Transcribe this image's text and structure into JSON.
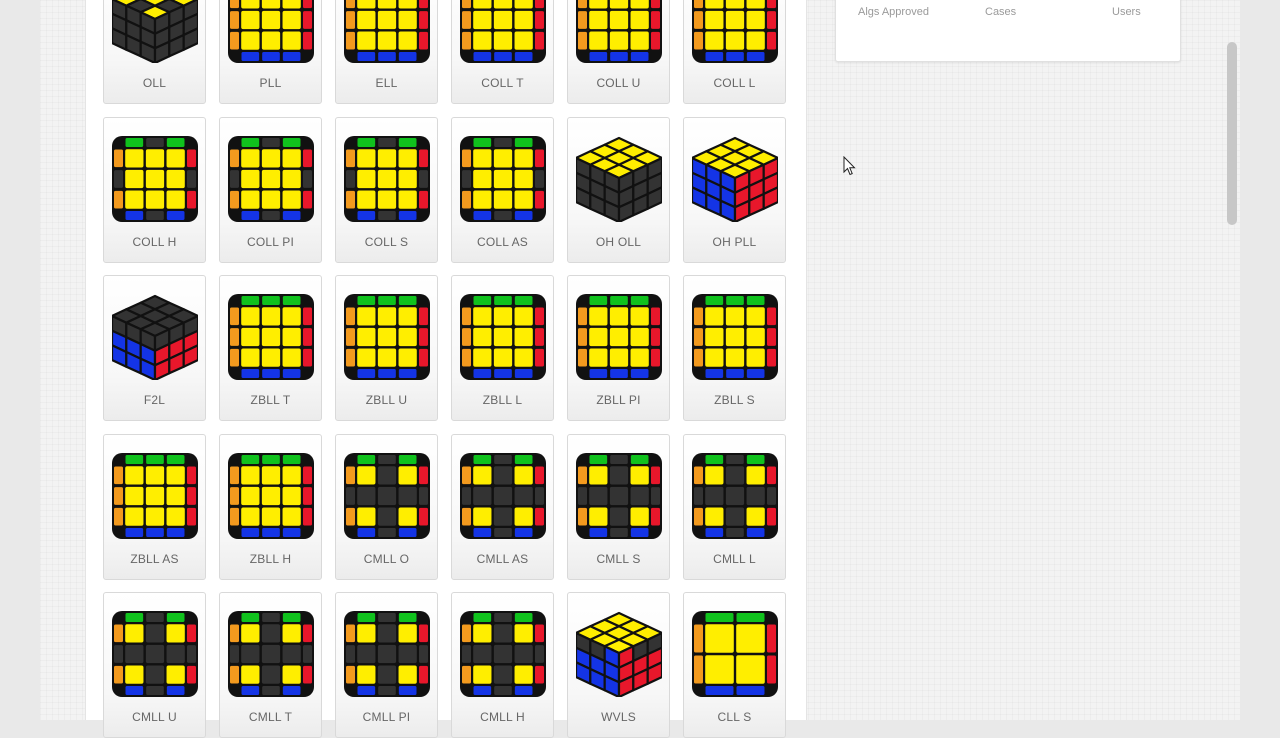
{
  "algsets": [
    {
      "label": "OLL",
      "icon": "oll-cube-icon"
    },
    {
      "label": "PLL",
      "icon": "pll-cube-icon"
    },
    {
      "label": "ELL",
      "icon": "ell-cube-icon"
    },
    {
      "label": "COLL T",
      "icon": "coll-t-cube-icon"
    },
    {
      "label": "COLL U",
      "icon": "coll-u-cube-icon"
    },
    {
      "label": "COLL L",
      "icon": "coll-l-cube-icon"
    },
    {
      "label": "COLL H",
      "icon": "coll-h-cube-icon"
    },
    {
      "label": "COLL PI",
      "icon": "coll-pi-cube-icon"
    },
    {
      "label": "COLL S",
      "icon": "coll-s-cube-icon"
    },
    {
      "label": "COLL AS",
      "icon": "coll-as-cube-icon"
    },
    {
      "label": "OH OLL",
      "icon": "oh-oll-cube-icon"
    },
    {
      "label": "OH PLL",
      "icon": "oh-pll-cube-icon"
    },
    {
      "label": "F2L",
      "icon": "f2l-cube-icon"
    },
    {
      "label": "ZBLL T",
      "icon": "zbll-t-cube-icon"
    },
    {
      "label": "ZBLL U",
      "icon": "zbll-u-cube-icon"
    },
    {
      "label": "ZBLL L",
      "icon": "zbll-l-cube-icon"
    },
    {
      "label": "ZBLL PI",
      "icon": "zbll-pi-cube-icon"
    },
    {
      "label": "ZBLL S",
      "icon": "zbll-s-cube-icon"
    },
    {
      "label": "ZBLL AS",
      "icon": "zbll-as-cube-icon"
    },
    {
      "label": "ZBLL H",
      "icon": "zbll-h-cube-icon"
    },
    {
      "label": "CMLL O",
      "icon": "cmll-o-cube-icon"
    },
    {
      "label": "CMLL AS",
      "icon": "cmll-as-cube-icon"
    },
    {
      "label": "CMLL S",
      "icon": "cmll-s-cube-icon"
    },
    {
      "label": "CMLL L",
      "icon": "cmll-l-cube-icon"
    },
    {
      "label": "CMLL U",
      "icon": "cmll-u-cube-icon"
    },
    {
      "label": "CMLL T",
      "icon": "cmll-t-cube-icon"
    },
    {
      "label": "CMLL PI",
      "icon": "cmll-pi-cube-icon"
    },
    {
      "label": "CMLL H",
      "icon": "cmll-h-cube-icon"
    },
    {
      "label": "WVLS",
      "icon": "wvls-cube-icon"
    },
    {
      "label": "CLL S",
      "icon": "cll-s-cube-icon"
    }
  ],
  "stats": {
    "algs_approved_label": "Algs Approved",
    "cases_label": "Cases",
    "users_label": "Users"
  },
  "colors": {
    "yellow": "#ffee00",
    "red": "#e8172b",
    "orange": "#f39a1e",
    "green": "#10c21d",
    "blue": "#1434e6",
    "gray": "#333333",
    "sticker_border": "#111111"
  }
}
